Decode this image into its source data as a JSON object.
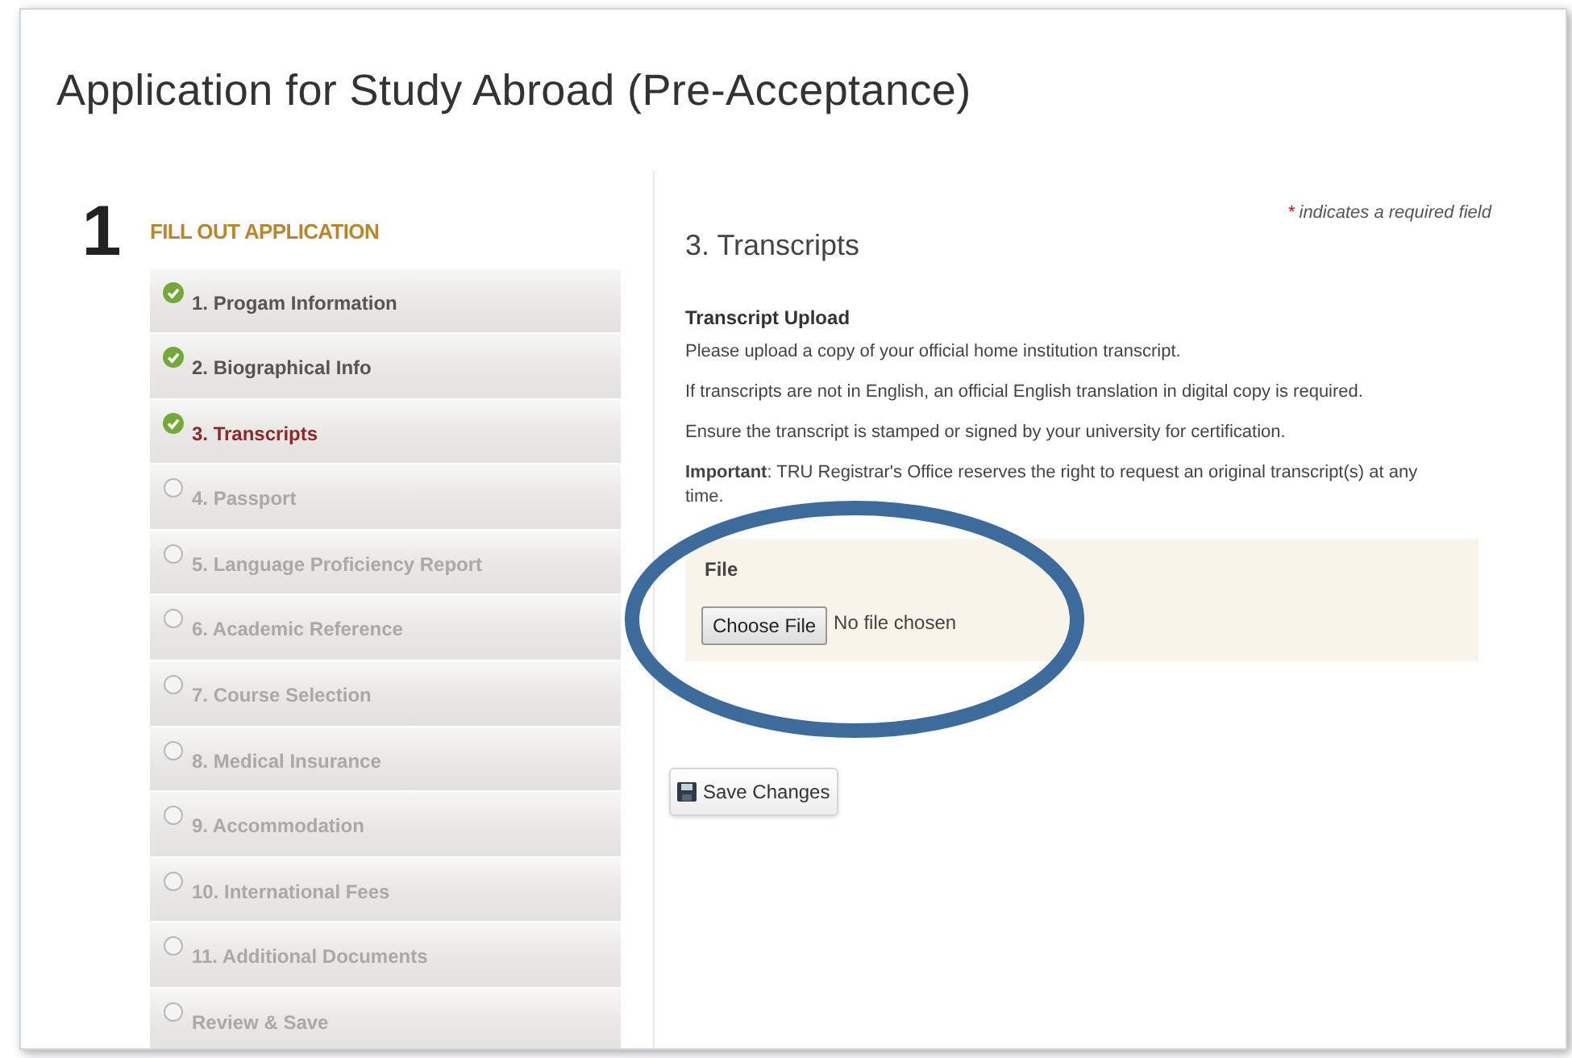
{
  "page_title": "Application for Study Abroad (Pre-Acceptance)",
  "step": {
    "number": "1",
    "heading": "FILL OUT APPLICATION"
  },
  "steps": [
    {
      "label": "1. Progam Information",
      "completed": true,
      "selected": false
    },
    {
      "label": "2. Biographical Info",
      "completed": true,
      "selected": false
    },
    {
      "label": "3. Transcripts",
      "completed": true,
      "selected": true
    },
    {
      "label": "4. Passport",
      "completed": false,
      "selected": false
    },
    {
      "label": "5. Language Proficiency Report",
      "completed": false,
      "selected": false
    },
    {
      "label": "6. Academic Reference",
      "completed": false,
      "selected": false
    },
    {
      "label": "7. Course Selection",
      "completed": false,
      "selected": false
    },
    {
      "label": "8. Medical Insurance",
      "completed": false,
      "selected": false
    },
    {
      "label": "9. Accommodation",
      "completed": false,
      "selected": false
    },
    {
      "label": "10. International Fees",
      "completed": false,
      "selected": false
    },
    {
      "label": "11. Additional Documents",
      "completed": false,
      "selected": false
    },
    {
      "label": "Review & Save",
      "completed": false,
      "selected": false
    }
  ],
  "required_note": {
    "mark": "*",
    "text": "indicates a required field"
  },
  "section_title": "3. Transcripts",
  "upload": {
    "heading": "Transcript Upload",
    "paragraphs": [
      "Please upload a copy of your official home institution transcript.",
      "If transcripts are not in English, an official English translation in digital copy is required.",
      "Ensure the transcript is stamped or signed by your university for certification.",
      "**Important**: TRU Registrar's Office reserves the right to request an original transcript(s) at any time."
    ]
  },
  "file_field": {
    "label": "File",
    "button": "Choose File",
    "status": "No file chosen"
  },
  "save_button": "Save Changes"
}
